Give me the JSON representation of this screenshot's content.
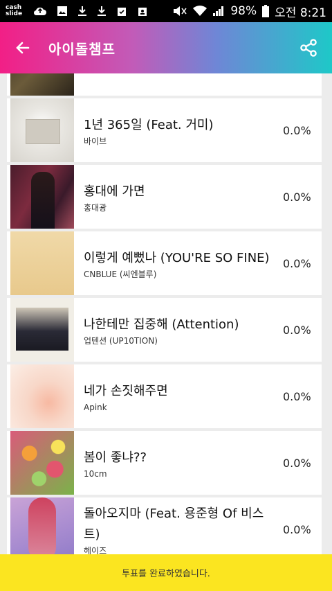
{
  "status_bar": {
    "cash_slide": "cash\nslide",
    "battery": "98%",
    "time": "오전 8:21"
  },
  "app_bar": {
    "title": "아이돌챔프",
    "back_icon": "arrow-left-icon",
    "share_icon": "share-icon"
  },
  "songs": [
    {
      "title": "",
      "artist": "",
      "pct": ""
    },
    {
      "title": "1년 365일 (Feat. 거미)",
      "artist": "바이브",
      "pct": "0.0%"
    },
    {
      "title": "홍대에 가면",
      "artist": "홍대광",
      "pct": "0.0%"
    },
    {
      "title": "이렇게 예뻤나 (YOU'RE SO FINE)",
      "artist": "CNBLUE (씨엔블루)",
      "pct": "0.0%"
    },
    {
      "title": "나한테만 집중해 (Attention)",
      "artist": "업텐션 (UP10TION)",
      "pct": "0.0%"
    },
    {
      "title": "네가 손짓해주면",
      "artist": "Apink",
      "pct": "0.0%"
    },
    {
      "title": "봄이 좋냐??",
      "artist": "10cm",
      "pct": "0.0%"
    },
    {
      "title": "돌아오지마 (Feat. 용준형 Of 비스트)",
      "artist": "헤이즈",
      "pct": "0.0%"
    }
  ],
  "toast": {
    "message": "투표를 완료하였습니다."
  },
  "colors": {
    "accent_pink": "#f21f86",
    "accent_teal": "#1ec8c8",
    "toast_yellow": "#fbe520"
  }
}
